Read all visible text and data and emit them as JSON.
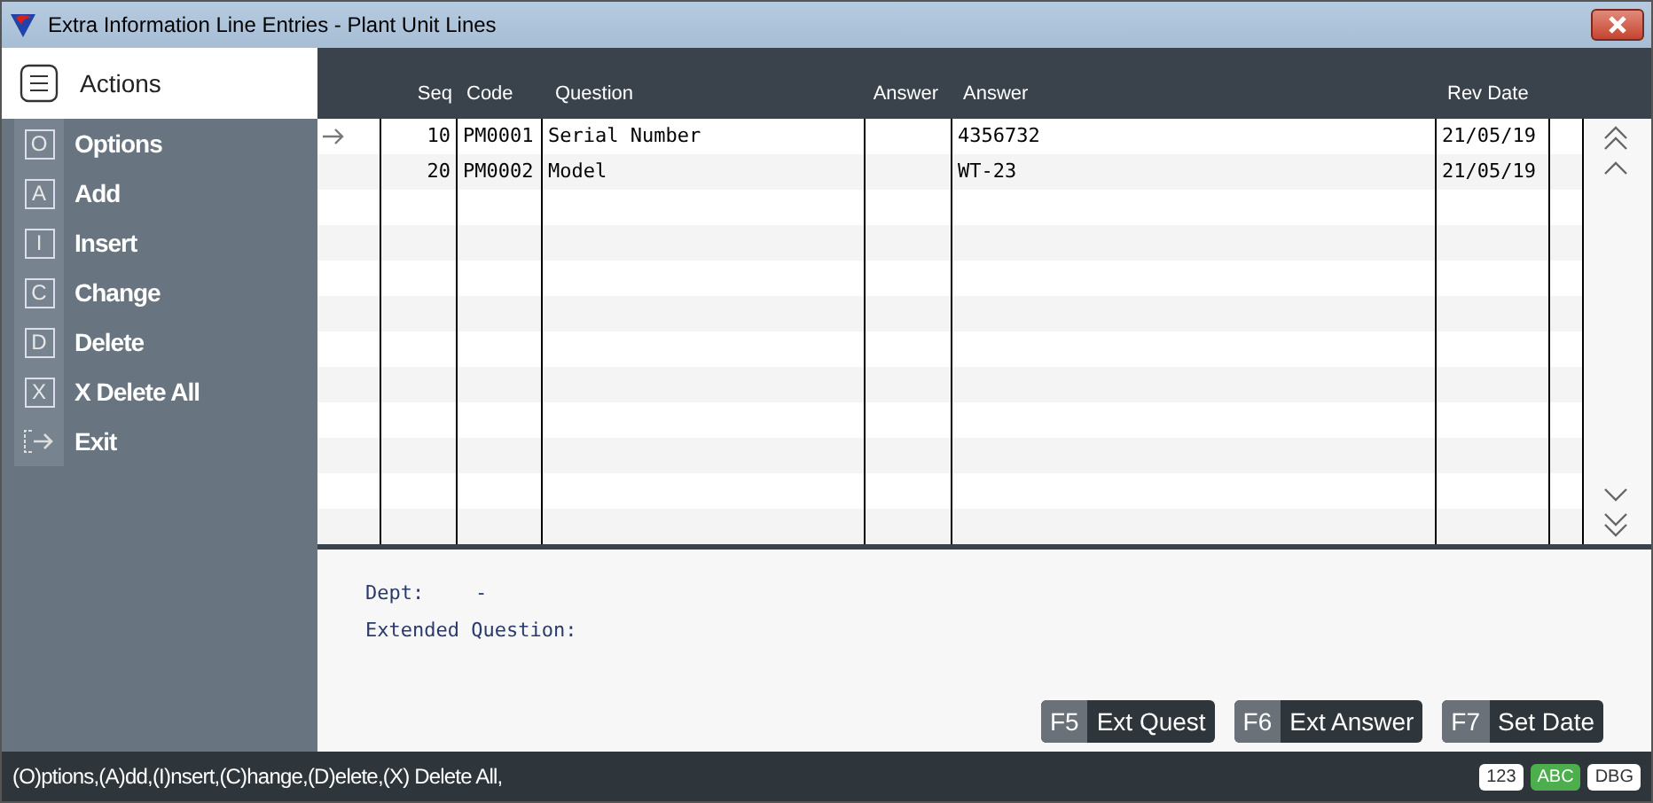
{
  "window": {
    "title": "Extra Information Line Entries  -  Plant Unit Lines"
  },
  "sidebar": {
    "title": "Actions",
    "items": [
      {
        "key": "O",
        "label": "Options",
        "kind": "key"
      },
      {
        "key": "A",
        "label": "Add",
        "kind": "key"
      },
      {
        "key": "I",
        "label": "Insert",
        "kind": "key"
      },
      {
        "key": "C",
        "label": "Change",
        "kind": "key"
      },
      {
        "key": "D",
        "label": "Delete",
        "kind": "key"
      },
      {
        "key": "X",
        "label": "X Delete All",
        "kind": "key"
      },
      {
        "label": "Exit",
        "kind": "exit"
      }
    ]
  },
  "table": {
    "columns": [
      "Seq",
      "Code",
      "Question",
      "Answer",
      "Answer",
      "Rev Date"
    ],
    "rows": [
      {
        "selected": true,
        "cells": [
          "10",
          "PM0001",
          "Serial Number",
          "",
          "4356732",
          "21/05/19"
        ]
      },
      {
        "selected": false,
        "cells": [
          "20",
          "PM0002",
          "Model",
          "",
          "WT-23",
          "21/05/19"
        ]
      }
    ]
  },
  "details": {
    "dept": {
      "label": "Dept:",
      "value": "-"
    },
    "extended_question": {
      "label": "Extended Question:"
    }
  },
  "buttons": [
    {
      "key": "F5",
      "label": "Ext Quest"
    },
    {
      "key": "F6",
      "label": "Ext Answer"
    },
    {
      "key": "F7",
      "label": "Set Date"
    }
  ],
  "status_bar": {
    "text": "(O)ptions,(A)dd,(I)nsert,(C)hange,(D)elete,(X) Delete All,",
    "indicators": [
      {
        "label": "123",
        "on": false
      },
      {
        "label": "ABC",
        "on": true
      },
      {
        "label": "DBG",
        "on": false
      }
    ]
  }
}
